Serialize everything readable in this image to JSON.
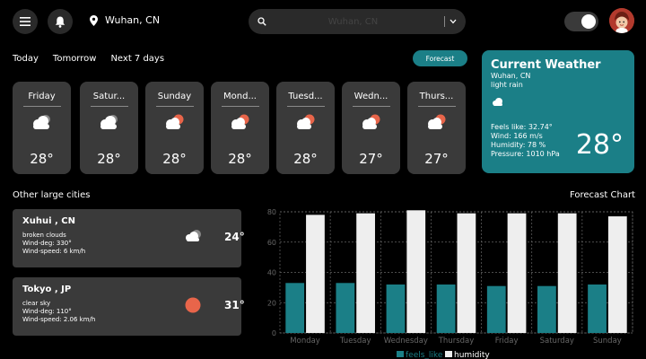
{
  "topbar": {
    "location": "Wuhan, CN",
    "search_placeholder": "Wuhan, CN"
  },
  "tabs": [
    "Today",
    "Tomorrow",
    "Next 7 days"
  ],
  "forecast_button": "Forecast",
  "days": [
    {
      "name": "Friday",
      "icon": "cloud-icon",
      "temp": "28°"
    },
    {
      "name": "Satur...",
      "icon": "cloud-icon",
      "temp": "28°"
    },
    {
      "name": "Sunday",
      "icon": "sun-cloud-icon",
      "temp": "28°"
    },
    {
      "name": "Mond...",
      "icon": "sun-cloud-icon",
      "temp": "28°"
    },
    {
      "name": "Tuesd...",
      "icon": "sun-cloud-icon",
      "temp": "28°"
    },
    {
      "name": "Wedn...",
      "icon": "sun-cloud-icon",
      "temp": "27°"
    },
    {
      "name": "Thurs...",
      "icon": "sun-cloud-icon",
      "temp": "27°"
    }
  ],
  "current": {
    "title": "Current Weather",
    "location": "Wuhan, CN",
    "description": "light rain",
    "feels_like": "Feels like: 32.74°",
    "wind": "Wind: 166 m/s",
    "humidity": "Humidity: 78 %",
    "pressure": "Pressure: 1010 hPa",
    "temp": "28°"
  },
  "other_cities_title": "Other large cities",
  "cities": [
    {
      "name": "Xuhui , CN",
      "description": "broken clouds",
      "wind_deg": "Wind-deg: 330°",
      "wind_speed": "Wind-speed: 6 km/h",
      "temp": "24°"
    },
    {
      "name": "Tokyo , JP",
      "description": "clear sky",
      "wind_deg": "Wind-deg: 110°",
      "wind_speed": "Wind-speed: 2.06 km/h",
      "temp": "31°"
    }
  ],
  "forecast_chart_title": "Forecast Chart",
  "chart_data": {
    "type": "bar",
    "categories": [
      "Monday",
      "Tuesday",
      "Wednesday",
      "Thursday",
      "Friday",
      "Saturday",
      "Sunday"
    ],
    "series": [
      {
        "name": "feels_like",
        "values": [
          33,
          33,
          32,
          32,
          31,
          31,
          32
        ],
        "color": "#1b7f87"
      },
      {
        "name": "humidity",
        "values": [
          78,
          79,
          81,
          79,
          79,
          79,
          77
        ],
        "color": "#eeeeee"
      }
    ],
    "ylim": [
      0,
      80
    ],
    "yticks": [
      0,
      20,
      40,
      60,
      80
    ],
    "grid": true,
    "legend": "bottom"
  },
  "colors": {
    "accent": "#1b7f87",
    "card": "#3a3a3a",
    "sun": "#e8654a"
  }
}
